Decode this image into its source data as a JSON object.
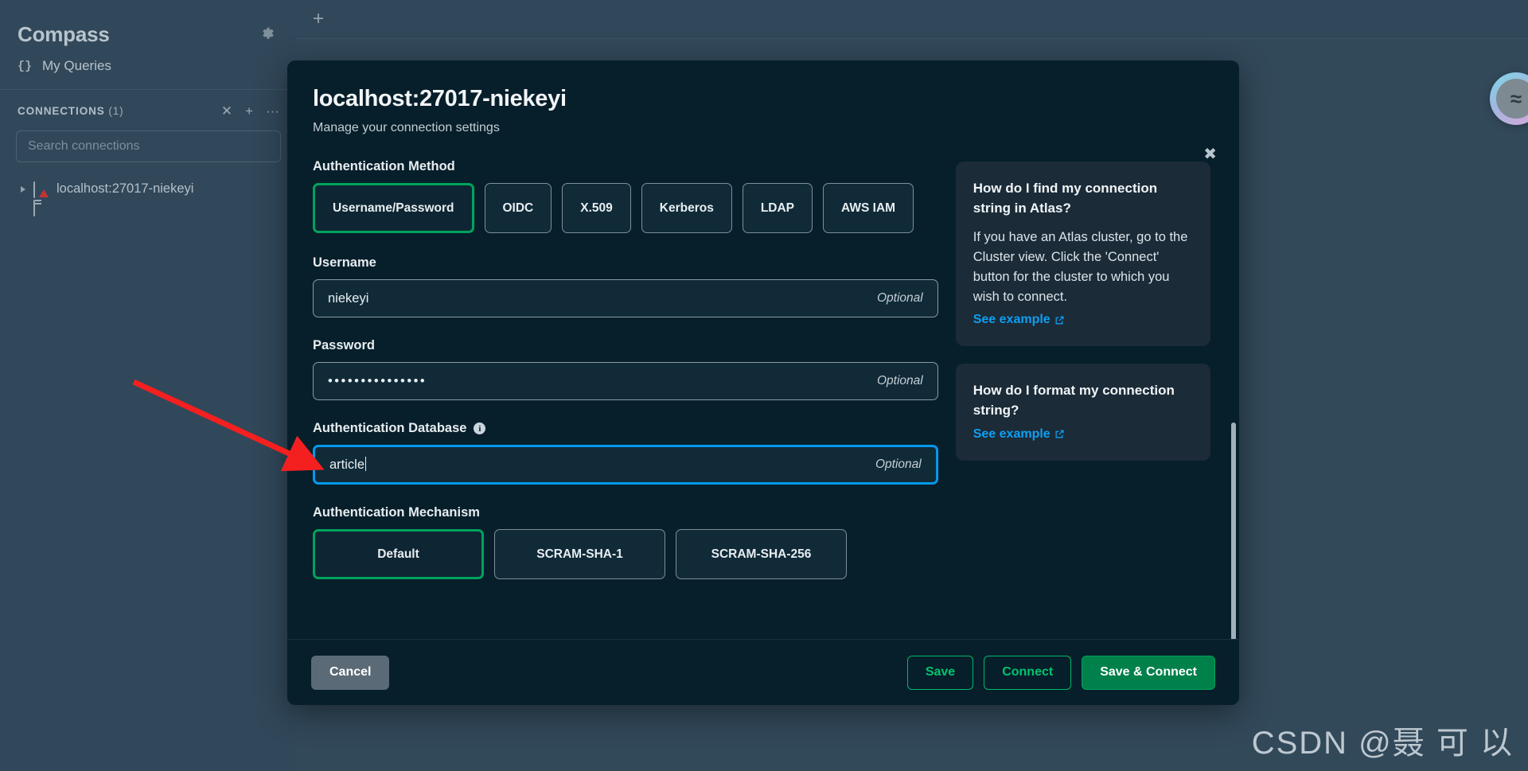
{
  "sidebar": {
    "logo": "Compass",
    "gear_icon": "gear-icon",
    "my_queries": {
      "icon": "braces-icon",
      "label": "My Queries"
    },
    "connections_header": {
      "title": "CONNECTIONS",
      "count": "(1)"
    },
    "connection_actions": [
      {
        "name": "collapse-all-icon",
        "glyph": "✕"
      },
      {
        "name": "add-connection-icon",
        "glyph": "+"
      },
      {
        "name": "more-options-icon",
        "glyph": "···"
      }
    ],
    "search": {
      "placeholder": "Search connections",
      "value": ""
    },
    "connection_items": [
      {
        "label": "localhost:27017-niekeyi",
        "icon": "server-icon",
        "has_warning": true
      }
    ]
  },
  "topbar": {
    "new_tab_label": "+"
  },
  "modal": {
    "title": "localhost:27017-niekeyi",
    "subtitle": "Manage your connection settings",
    "close_label": "✖",
    "auth_method": {
      "label": "Authentication Method",
      "options": [
        "Username/Password",
        "OIDC",
        "X.509",
        "Kerberos",
        "LDAP",
        "AWS IAM"
      ],
      "selected": "Username/Password"
    },
    "username": {
      "label": "Username",
      "value": "niekeyi",
      "optional_label": "Optional"
    },
    "password": {
      "label": "Password",
      "value": "•••••••••••••••",
      "optional_label": "Optional"
    },
    "auth_database": {
      "label": "Authentication Database",
      "info_glyph": "i",
      "value": "article",
      "optional_label": "Optional",
      "focused": true,
      "focus_color": "#0498ec"
    },
    "auth_mechanism": {
      "label": "Authentication Mechanism",
      "options": [
        "Default",
        "SCRAM-SHA-1",
        "SCRAM-SHA-256"
      ],
      "selected": "Default"
    },
    "help_cards": [
      {
        "title": "How do I find my connection string in Atlas?",
        "text": "If you have an Atlas cluster, go to the Cluster view. Click the 'Connect' button for the cluster to which you wish to connect.",
        "link": "See example",
        "link_icon": "external-link-icon"
      },
      {
        "title": "How do I format my connection string?",
        "text": "",
        "link": "See example",
        "link_icon": "external-link-icon"
      }
    ],
    "footer": {
      "cancel": "Cancel",
      "save": "Save",
      "connect": "Connect",
      "save_and_connect": "Save & Connect"
    }
  },
  "watermark": "CSDN @聂 可 以",
  "avatar": {
    "glyph": "≈"
  },
  "colors": {
    "accent_green": "#00a35c",
    "focus_blue": "#0498ec",
    "link_blue": "#0e9ff2",
    "modal_bg": "#071f2b",
    "app_bg": "#32495a",
    "arrow_red": "#f42020"
  }
}
